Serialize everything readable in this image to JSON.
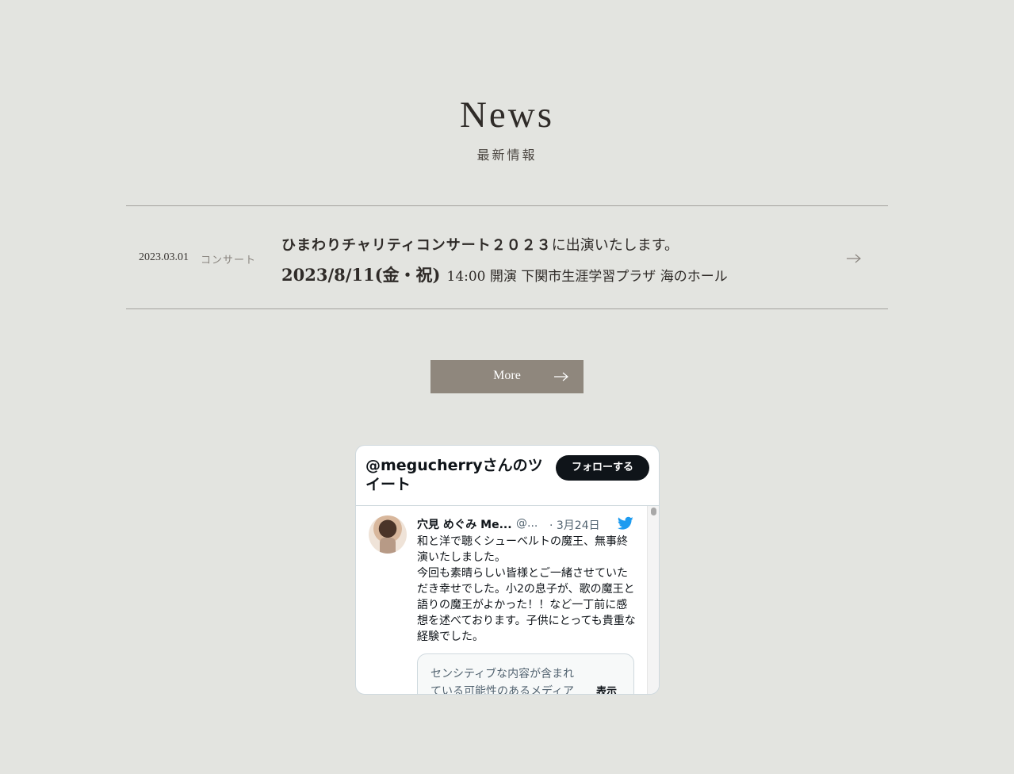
{
  "section": {
    "title": "News",
    "subtitle": "最新情報"
  },
  "news_items": [
    {
      "date": "2023.03.01",
      "category": "コンサート",
      "headline_bold": "ひまわりチャリティコンサート２０２３",
      "headline_rest": "に出演いたします。",
      "detail_bold": "2023/8/11(金・祝)",
      "detail_rest": "14:00 開演 下関市生涯学習プラザ 海のホール"
    }
  ],
  "more_button": {
    "label": "More"
  },
  "twitter_widget": {
    "title": "@megucherryさんのツイート",
    "follow_label": "フォローする",
    "tweet": {
      "author_name": "穴見 めぐみ Me...",
      "author_handle": "@...",
      "date": "· 3月24日",
      "text": "和と洋で聴くシューベルトの魔王、無事終演いたしました。\n今回も素晴らしい皆様とご一緒させていただき幸せでした。小2の息子が、歌の魔王と語りの魔王がよかった！！など一丁前に感想を述べております。子供にとっても貴重な経験でした。",
      "sensitive_notice": "センシティブな内容が含まれている可能性のあるメディアです",
      "show_label": "表示"
    }
  },
  "colors": {
    "background": "#e3e4e0",
    "more_button": "#8f877d",
    "follow_button": "#0f1419",
    "twitter_blue": "#1d9bf0"
  },
  "icons": {
    "news_arrow": "arrow-right-icon",
    "more_arrow": "arrow-right-icon",
    "twitter": "twitter-bird-icon"
  }
}
